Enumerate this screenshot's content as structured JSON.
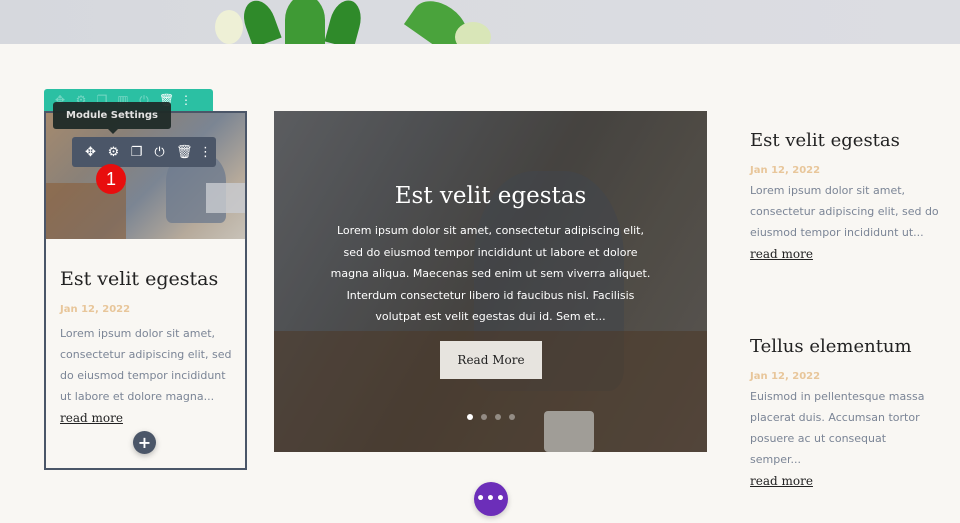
{
  "toolbar": {
    "tooltip": "Module Settings",
    "row_icons": [
      "move-icon",
      "gear-icon",
      "duplicate-icon",
      "columns-icon",
      "power-icon",
      "trash-icon",
      "more-icon"
    ],
    "module_icons": [
      "move-icon",
      "gear-icon",
      "duplicate-icon",
      "power-icon",
      "trash-icon",
      "more-icon"
    ],
    "badge": "1",
    "row_color": "#2bc0a3",
    "module_color": "#4b5668"
  },
  "left_post": {
    "title": "Est velit egestas",
    "date": "Jan 12, 2022",
    "excerpt": "Lorem ipsum dolor sit amet, consectetur adipiscing elit, sed do eiusmod tempor incididunt ut labore et dolore magna...",
    "read_more": "read more",
    "add_label": "+"
  },
  "slider": {
    "title": "Est velit egestas",
    "text": "Lorem ipsum dolor sit amet, consectetur adipiscing elit, sed do eiusmod tempor incididunt ut labore et dolore magna aliqua. Maecenas sed enim ut sem viverra aliquet. Interdum consectetur libero id faucibus nisl. Facilisis volutpat est velit egestas dui id. Sem et...",
    "button": "Read More",
    "slides": 4,
    "active_slide": 1
  },
  "right_posts": [
    {
      "title": "Est velit egestas",
      "date": "Jan 12, 2022",
      "excerpt": "Lorem ipsum dolor sit amet, consectetur adipiscing elit, sed do eiusmod tempor incididunt ut...",
      "read_more": "read more"
    },
    {
      "title": "Tellus elementum",
      "date": "Jan 12, 2022",
      "excerpt": "Euismod in pellentesque massa placerat duis. Accumsan tortor posuere ac ut consequat semper...",
      "read_more": "read more"
    }
  ],
  "section_more": "•••",
  "colors": {
    "accent_purple": "#6c2eb9",
    "date": "#e8c69a",
    "badge_red": "#e80e0e"
  }
}
